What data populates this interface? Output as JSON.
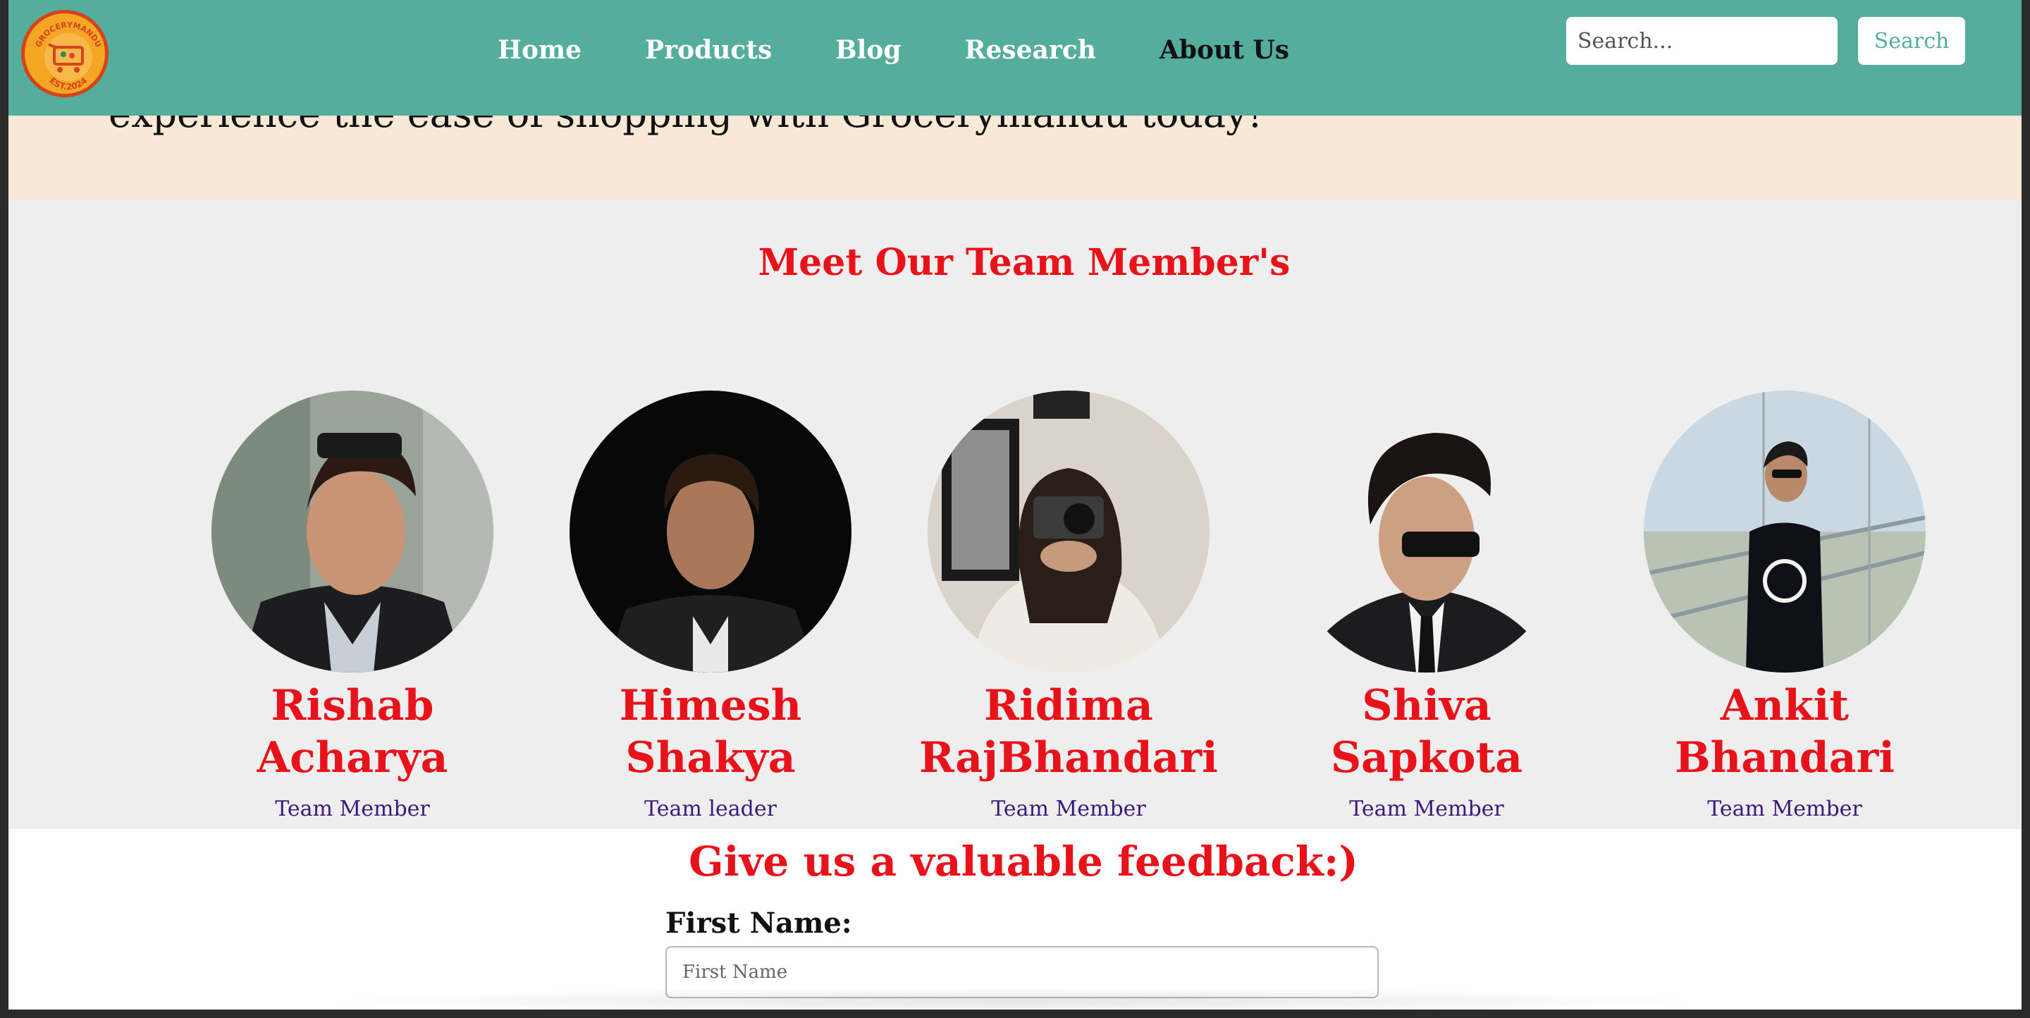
{
  "brand": {
    "logo_alt": "Grocerymandu logo",
    "logo_top_text": "GROCERYMANDU",
    "logo_bottom_text": "EST.2024"
  },
  "nav": {
    "links": [
      "Home",
      "Products",
      "Blog",
      "Research",
      "About Us"
    ],
    "active": "About Us",
    "search_placeholder": "Search...",
    "search_button": "Search"
  },
  "intro": {
    "text": "experience the ease of shopping with Grocerymandu today!"
  },
  "team": {
    "title": "Meet Our Team Member's",
    "members": [
      {
        "name": "Rishab\nAcharya",
        "role": "Team Member"
      },
      {
        "name": "Himesh\nShakya",
        "role": "Team leader"
      },
      {
        "name": "Ridima\nRajBhandari",
        "role": "Team Member"
      },
      {
        "name": "Shiva\nSapkota",
        "role": "Team Member"
      },
      {
        "name": "Ankit\nBhandari",
        "role": "Team Member"
      }
    ]
  },
  "feedback": {
    "title": "Give us a valuable feedback:)",
    "first_name_label": "First Name:",
    "first_name_placeholder": "First Name"
  },
  "colors": {
    "navbar": "#55ad9b",
    "accent_red": "#e8121a",
    "role_purple": "#3b1a7a",
    "intro_band": "#f8e8d6",
    "team_bg": "#eeeeee"
  }
}
